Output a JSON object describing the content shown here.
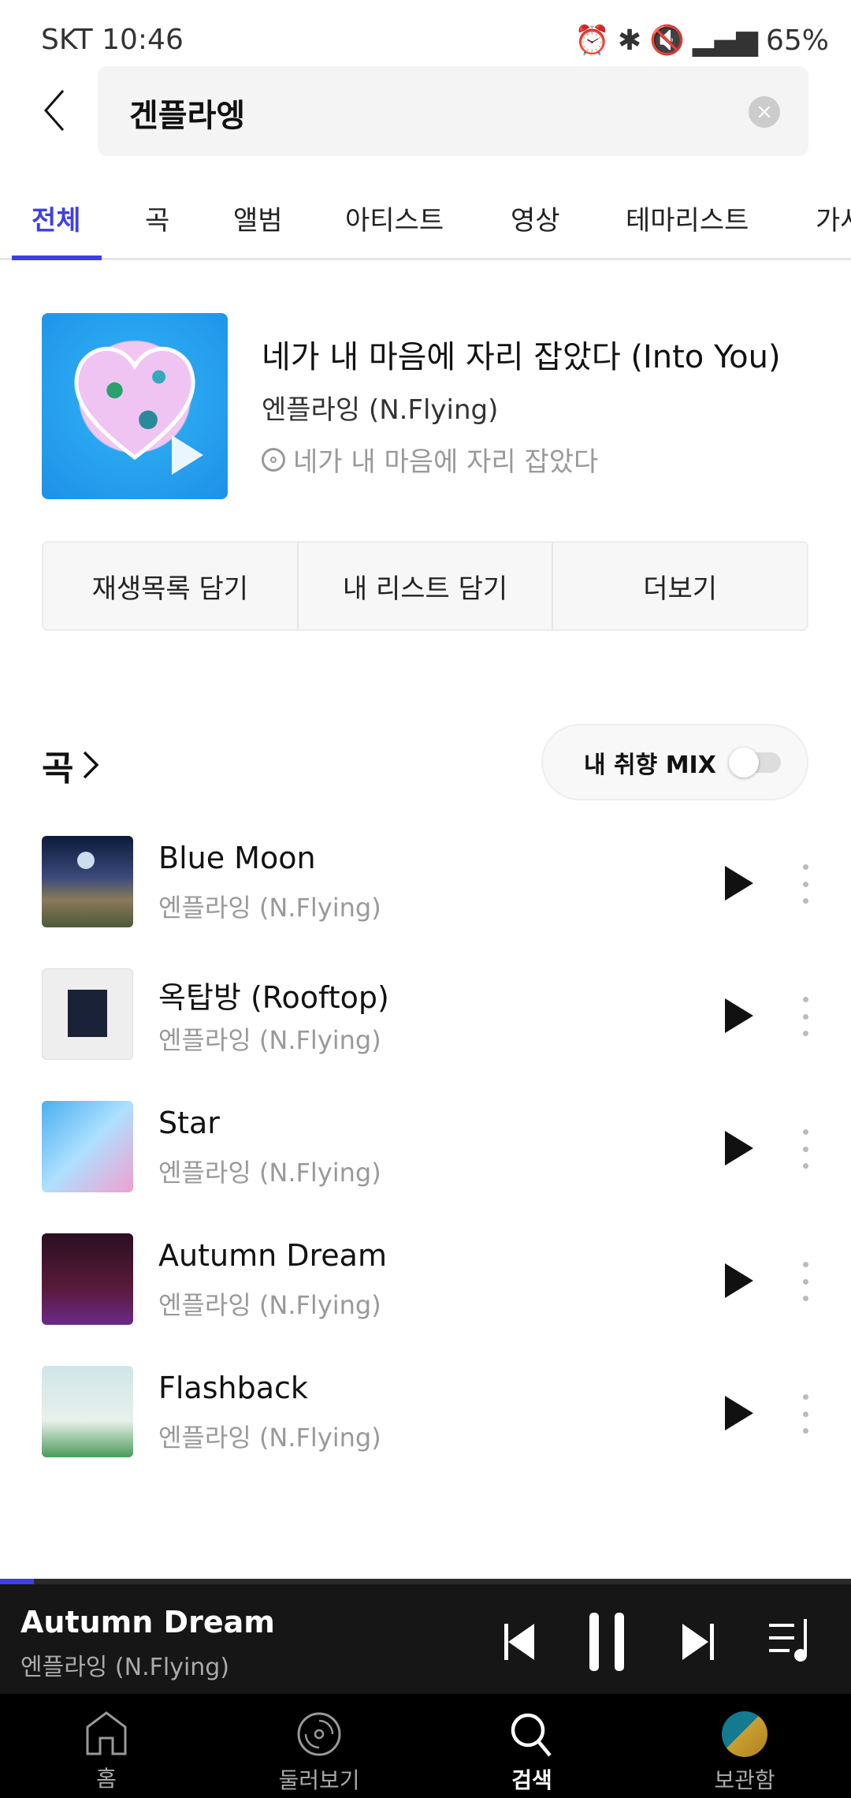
{
  "status_bar": {
    "carrier": "SKT",
    "time": "10:46",
    "battery": "65%"
  },
  "search": {
    "query": "겐플라엥"
  },
  "tabs": [
    "전체",
    "곡",
    "앨범",
    "아티스트",
    "영상",
    "테마리스트",
    "가사"
  ],
  "top_result": {
    "title": "네가 내 마음에 자리 잡았다 (Into You)",
    "artist": "엔플라잉 (N.Flying)",
    "album": "네가 내 마음에 자리 잡았다"
  },
  "actions": [
    "재생목록 담기",
    "내 리스트 담기",
    "더보기"
  ],
  "songs_section": {
    "title": "곡",
    "mix_label": "내 취향 MIX",
    "mix_on": false
  },
  "songs": [
    {
      "title": "Blue Moon",
      "artist": "엔플라잉 (N.Flying)"
    },
    {
      "title": "옥탑방 (Rooftop)",
      "artist": "엔플라잉 (N.Flying)"
    },
    {
      "title": "Star",
      "artist": "엔플라잉 (N.Flying)"
    },
    {
      "title": "Autumn Dream",
      "artist": "엔플라잉 (N.Flying)"
    },
    {
      "title": "Flashback",
      "artist": "엔플라잉 (N.Flying)"
    }
  ],
  "player": {
    "title": "Autumn Dream",
    "artist": "엔플라잉 (N.Flying)",
    "progress_percent": 4,
    "accent": "#3f3fe6"
  },
  "nav": [
    "홈",
    "둘러보기",
    "검색",
    "보관함"
  ]
}
